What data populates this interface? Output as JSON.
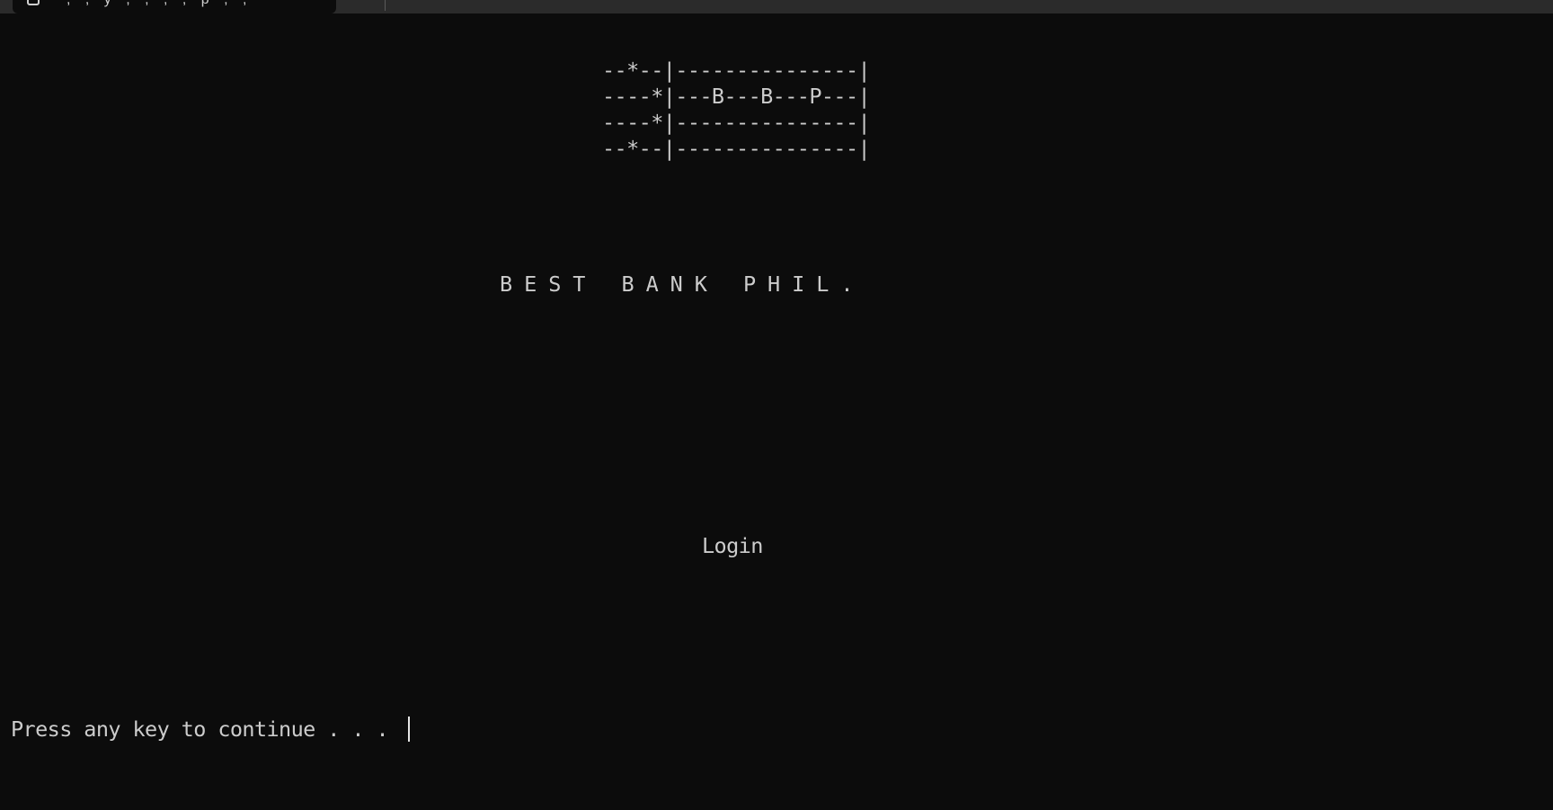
{
  "window": {
    "tab_title_fragment": ", , y , , , , p , ,",
    "tab_icon": "terminal-icon"
  },
  "terminal": {
    "art_lines": [
      "--*--|---------------|",
      "----*|---B---B---P---|",
      "----*|---------------|",
      "--*--|---------------|"
    ],
    "bank_name": "B E S T   B A N K   P H I L .",
    "login_label": "Login",
    "prompt": "Press any key to continue . . . "
  },
  "colors": {
    "background": "#0c0c0c",
    "foreground": "#cccccc",
    "tabbar": "#2b2b2b"
  }
}
